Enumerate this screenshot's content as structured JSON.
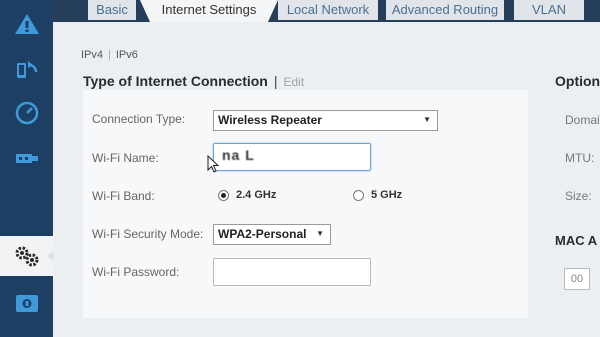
{
  "tabs": [
    {
      "label": "Basic",
      "active": false
    },
    {
      "label": "Internet Settings",
      "active": true
    },
    {
      "label": "Local Network",
      "active": false
    },
    {
      "label": "Advanced Routing",
      "active": false
    },
    {
      "label": "VLAN",
      "active": false
    }
  ],
  "sidebar": {
    "items": [
      {
        "icon": "network-warning-icon"
      },
      {
        "icon": "device-sync-icon"
      },
      {
        "icon": "speed-dial-icon"
      },
      {
        "icon": "usb-icon"
      },
      {
        "icon": "settings-gears-icon",
        "active": true
      },
      {
        "icon": "media-icon"
      }
    ]
  },
  "ip_versions": {
    "ipv4": "IPv4",
    "ipv6": "IPv6"
  },
  "connection": {
    "title": "Type of Internet Connection",
    "edit_label": "Edit",
    "fields": {
      "connection_type": {
        "label": "Connection Type:",
        "value": "Wireless Repeater"
      },
      "wifi_name": {
        "label": "Wi-Fi Name:",
        "value": "na L"
      },
      "wifi_band": {
        "label": "Wi-Fi Band:",
        "options": [
          {
            "label": "2.4 GHz",
            "checked": true
          },
          {
            "label": "5 GHz",
            "checked": false
          }
        ]
      },
      "security_mode": {
        "label": "Wi-Fi Security Mode:",
        "value": "WPA2-Personal"
      },
      "password": {
        "label": "Wi-Fi Password:",
        "value": ""
      }
    }
  },
  "optional": {
    "title": "Option",
    "domain_label": "Domai",
    "mtu_label": "MTU:",
    "size_label": "Size:",
    "mac_title": "MAC A",
    "mac_first_octet": "00"
  },
  "colors": {
    "sidebar": "#1c3f63",
    "tabbar": "#253f5a",
    "accent": "#1f6fb2"
  }
}
